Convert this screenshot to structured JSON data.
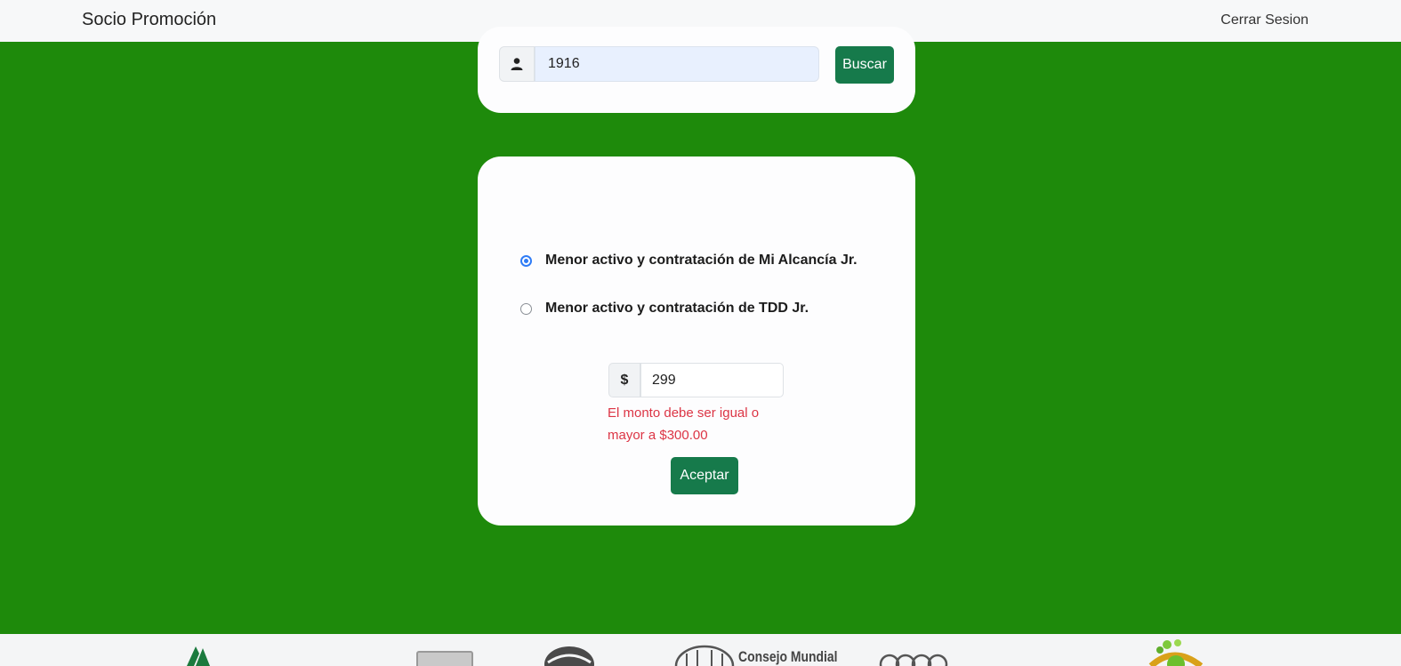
{
  "navbar": {
    "brand": "Socio Promoción",
    "logout": "Cerrar Sesion"
  },
  "search": {
    "member_value": "1916",
    "button_label": "Buscar",
    "icon": "user-icon"
  },
  "form": {
    "options": [
      {
        "label": "Menor activo y contratación de Mi Alcancía Jr.",
        "selected": true
      },
      {
        "label": "Menor activo y contratación de TDD Jr.",
        "selected": false
      }
    ],
    "currency_symbol": "$",
    "amount_value": "299",
    "error_message": "El monto debe ser igual o mayor a $300.00",
    "submit_label": "Aceptar"
  },
  "footer": {
    "partner_text": "Consejo Mundial"
  },
  "colors": {
    "background": "#1e8a0b",
    "primary_button": "#167a4b",
    "error": "#dc3545",
    "radio_accent": "#2f7cf6"
  }
}
